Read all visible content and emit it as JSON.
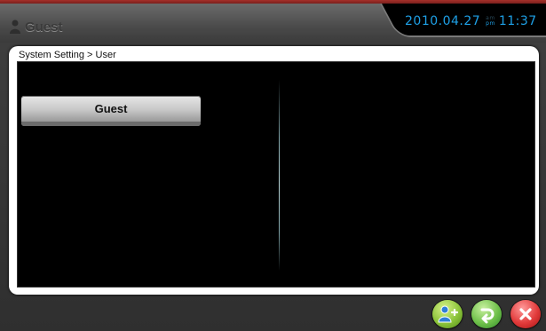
{
  "header": {
    "user_label": "Guest",
    "user_icon": "person-icon",
    "date": "2010.04.27",
    "am_label": "am",
    "pm_label": "pm",
    "time": "11:37"
  },
  "panel": {
    "breadcrumb": "System Setting > User",
    "users": [
      {
        "label": "Guest"
      }
    ]
  },
  "actions": [
    {
      "name": "add-user-button",
      "icon": "add-user-icon",
      "color": "#8cc43a"
    },
    {
      "name": "return-button",
      "icon": "return-arrow-icon",
      "color": "#6fc04a"
    },
    {
      "name": "close-button",
      "icon": "close-x-icon",
      "color": "#e23b3b"
    }
  ],
  "colors": {
    "accent_red": "#a4302a",
    "clock_blue": "#1ea0e6"
  }
}
